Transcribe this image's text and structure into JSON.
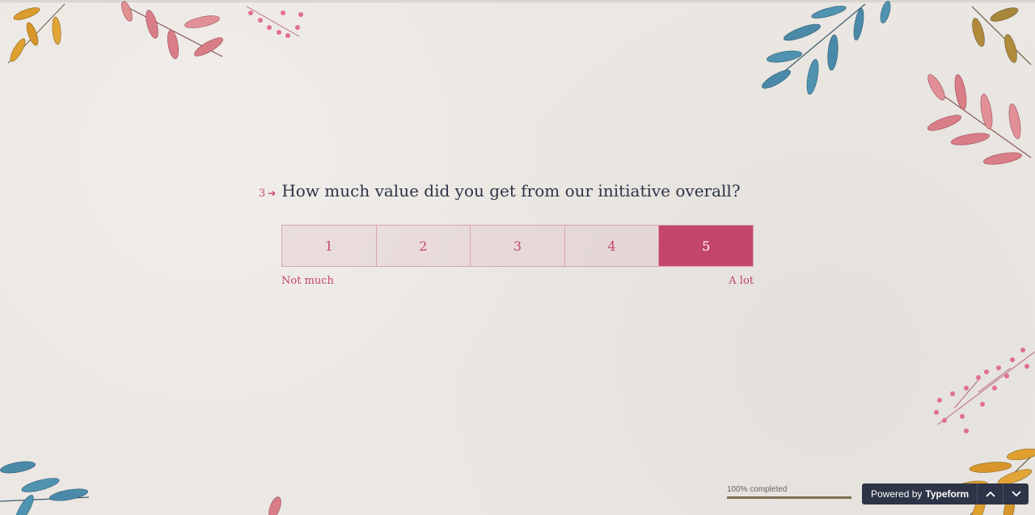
{
  "question": {
    "number": "3",
    "arrow": "➔",
    "text": "How much value did you get from our initiative overall?"
  },
  "scale": {
    "options": [
      "1",
      "2",
      "3",
      "4",
      "5"
    ],
    "selected": "5",
    "label_left": "Not much",
    "label_right": "A lot"
  },
  "progress": {
    "text": "100% completed",
    "percent": 100
  },
  "footer": {
    "powered_prefix": "Powered by",
    "powered_brand": "Typeform",
    "nav_up_icon": "chevron-up-icon",
    "nav_down_icon": "chevron-down-icon"
  },
  "colors": {
    "accent": "#c4466a",
    "question_text": "#2d3446",
    "background": "#ebe7e3",
    "footer_bg": "#2e3447"
  }
}
